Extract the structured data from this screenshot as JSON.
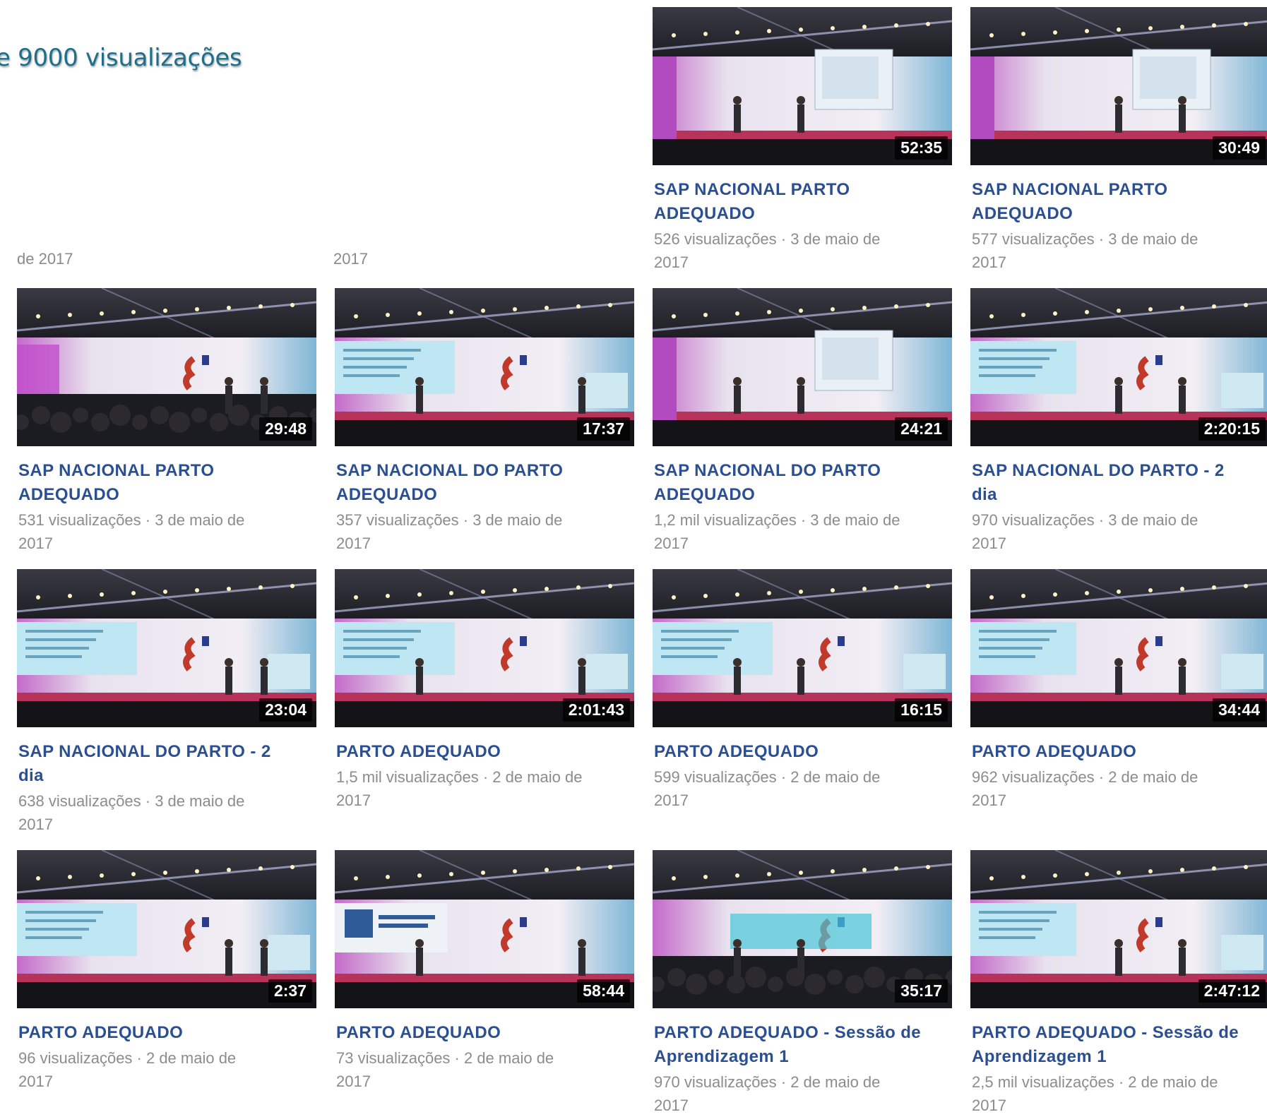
{
  "page": {
    "heading": "e 9000 visualizações",
    "cut_texts": [
      "de 2017",
      "2017"
    ]
  },
  "colors": {
    "heading": "#1f6f8b",
    "title": "#2b4f93",
    "meta": "#8c8c8c",
    "duration_bg": "#000000"
  },
  "videos": [
    {
      "title_lines": [
        "SAP NACIONAL PARTO",
        "ADEQUADO"
      ],
      "meta_lines": [
        "526 visualizações · 3 de maio de",
        "2017"
      ],
      "duration": "52:35"
    },
    {
      "title_lines": [
        "SAP NACIONAL PARTO",
        "ADEQUADO"
      ],
      "meta_lines": [
        "577 visualizações · 3 de maio de",
        "2017"
      ],
      "duration": "30:49"
    },
    {
      "title_lines": [
        "SAP NACIONAL PARTO",
        "ADEQUADO"
      ],
      "meta_lines": [
        "531 visualizações · 3 de maio de",
        "2017"
      ],
      "duration": "29:48"
    },
    {
      "title_lines": [
        "SAP NACIONAL DO PARTO",
        "ADEQUADO"
      ],
      "meta_lines": [
        "357 visualizações · 3 de maio de",
        "2017"
      ],
      "duration": "17:37"
    },
    {
      "title_lines": [
        "SAP NACIONAL DO PARTO",
        "ADEQUADO"
      ],
      "meta_lines": [
        "1,2 mil visualizações · 3 de maio de",
        "2017"
      ],
      "duration": "24:21"
    },
    {
      "title_lines": [
        "SAP NACIONAL DO PARTO - 2",
        "dia"
      ],
      "meta_lines": [
        "970 visualizações · 3 de maio de",
        "2017"
      ],
      "duration": "2:20:15"
    },
    {
      "title_lines": [
        "SAP NACIONAL DO PARTO - 2",
        "dia"
      ],
      "meta_lines": [
        "638 visualizações · 3 de maio de",
        "2017"
      ],
      "duration": "23:04"
    },
    {
      "title_lines": [
        "PARTO ADEQUADO"
      ],
      "meta_lines": [
        "1,5 mil visualizações · 2 de maio de",
        "2017"
      ],
      "duration": "2:01:43"
    },
    {
      "title_lines": [
        "PARTO ADEQUADO"
      ],
      "meta_lines": [
        "599 visualizações · 2 de maio de",
        "2017"
      ],
      "duration": "16:15"
    },
    {
      "title_lines": [
        "PARTO ADEQUADO"
      ],
      "meta_lines": [
        "962 visualizações · 2 de maio de",
        "2017"
      ],
      "duration": "34:44"
    },
    {
      "title_lines": [
        "PARTO ADEQUADO"
      ],
      "meta_lines": [
        "96 visualizações · 2 de maio de",
        "2017"
      ],
      "duration": "2:37"
    },
    {
      "title_lines": [
        "PARTO ADEQUADO"
      ],
      "meta_lines": [
        "73 visualizações · 2 de maio de",
        "2017"
      ],
      "duration": "58:44"
    },
    {
      "title_lines": [
        "PARTO ADEQUADO - Sessão de",
        "Aprendizagem 1"
      ],
      "meta_lines": [
        "970 visualizações · 2 de maio de",
        "2017"
      ],
      "duration": "35:17"
    },
    {
      "title_lines": [
        "PARTO ADEQUADO - Sessão de",
        "Aprendizagem 1"
      ],
      "meta_lines": [
        "2,5 mil visualizações · 2 de maio de",
        "2017"
      ],
      "duration": "2:47:12"
    }
  ]
}
